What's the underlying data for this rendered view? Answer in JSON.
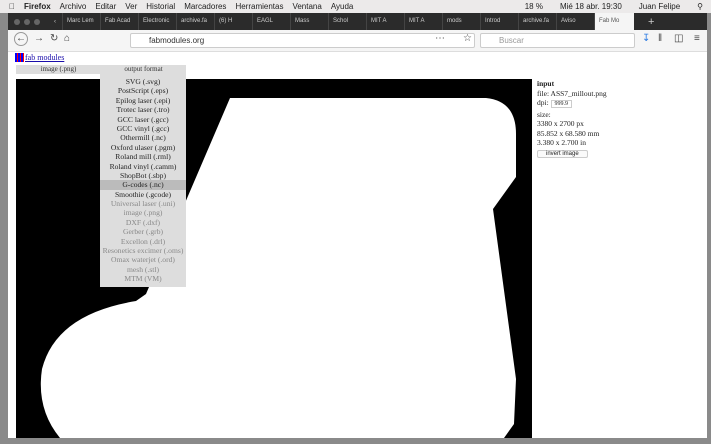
{
  "menubar": {
    "app": "Firefox",
    "items": [
      "Archivo",
      "Editar",
      "Ver",
      "Historial",
      "Marcadores",
      "Herramientas",
      "Ventana",
      "Ayuda"
    ],
    "battery": "18 %",
    "clock": "Mié 18 abr. 19:30",
    "user": "Juan Felipe"
  },
  "tabs": [
    "Marc Lem",
    "Fab Acad",
    "Electronic",
    "archive.fa",
    "(6) H",
    "EAGL",
    "Mass",
    "Schol",
    "MIT A",
    "MIT A",
    "mods",
    "Introd",
    "archive.fa",
    "Aviso",
    "Fab Mo"
  ],
  "browser": {
    "url": "fabmodules.org",
    "search_placeholder": "Buscar"
  },
  "page": {
    "logo": "fab modules",
    "input_header": "image (.png)",
    "output_header": "output format",
    "formats": [
      {
        "label": "SVG (.svg)",
        "enabled": true
      },
      {
        "label": "PostScript (.eps)",
        "enabled": true
      },
      {
        "label": "Epilog laser (.epi)",
        "enabled": true
      },
      {
        "label": "Trotec laser (.tro)",
        "enabled": true
      },
      {
        "label": "GCC laser (.gcc)",
        "enabled": true
      },
      {
        "label": "GCC vinyl (.gcc)",
        "enabled": true
      },
      {
        "label": "Othermill (.nc)",
        "enabled": true
      },
      {
        "label": "Oxford ulaser (.pgm)",
        "enabled": true
      },
      {
        "label": "Roland mill (.rml)",
        "enabled": true
      },
      {
        "label": "Roland vinyl (.camm)",
        "enabled": true
      },
      {
        "label": "ShopBot (.sbp)",
        "enabled": true
      },
      {
        "label": "G-codes (.nc)",
        "enabled": true,
        "selected": true
      },
      {
        "label": "Smoothie (.gcode)",
        "enabled": true
      },
      {
        "label": "Universal laser (.uni)",
        "enabled": false
      },
      {
        "label": "image (.png)",
        "enabled": false
      },
      {
        "label": "DXF (.dxf)",
        "enabled": false
      },
      {
        "label": "Gerber (.grb)",
        "enabled": false
      },
      {
        "label": "Excellon (.drl)",
        "enabled": false
      },
      {
        "label": "Resonetics excimer (.oms)",
        "enabled": false
      },
      {
        "label": "Omax waterjet (.ord)",
        "enabled": false
      },
      {
        "label": "mesh (.stl)",
        "enabled": false
      },
      {
        "label": "MTM (VM)",
        "enabled": false
      }
    ],
    "info": {
      "title": "input",
      "file": "file: ASS7_millout.png",
      "dpi_label": "dpi:",
      "dpi": "999.9",
      "size_label": "size:",
      "px": "3380 x 2700 px",
      "mm": "85.852 x 68.580 mm",
      "in": "3.380 x 2.700 in",
      "invert": "invert image"
    }
  }
}
